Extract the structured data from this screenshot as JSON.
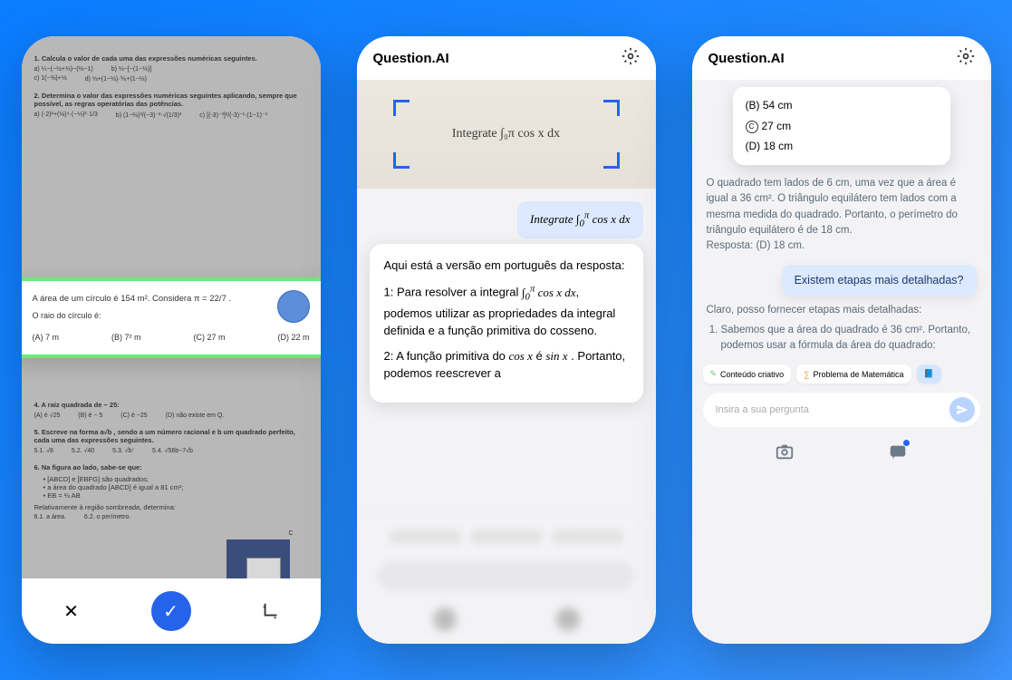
{
  "phone1": {
    "sections": {
      "s1_title": "1. Calcula o valor de cada uma das expressões numéricas seguintes.",
      "s2_title": "2. Determina o valor das expressões numéricas seguintes aplicando, sempre que possível, as regras operatórias das potências.",
      "s4_title": "4. A raiz quadrada de − 25:",
      "s4_a": "(A) é √25",
      "s4_b": "(B) é − 5",
      "s4_c": "(C) é −25",
      "s4_d": "(D) não existe em Q.",
      "s5_title": "5. Escreve na forma a√b , sendo a um número racional e b um quadrado perfeito, cada uma das expressões seguintes.",
      "s5_1": "5.1. √8",
      "s5_2": "5.2. √40",
      "s5_3": "5.3. √b⁷",
      "s5_4": "5.4. √56b−7√b",
      "s6_title": "6. Na figura ao lado, sabe-se que:",
      "s6_b1": "• [ABCD] e [EBFG] são quadrados;",
      "s6_b2": "• a área do quadrado [ABCD] é igual a 81 cm²;",
      "s6_b3": "• EB = ⅔ AB",
      "s6_rel": "Relativamente à região sombreada, determina:",
      "s6_1": "6.1.   a área.",
      "s6_2": "6.2.   o perímetro."
    },
    "highlight": {
      "question": "A área de um círculo é 154 m². Considera π = 22/7 .",
      "prompt": "O raio do círculo é:",
      "opts": {
        "a": "(A) 7 m",
        "b": "(B) 7² m",
        "c": "(C) 27 m",
        "d": "(D) 22 m"
      }
    },
    "buttons": {
      "close": "✕",
      "confirm": "✓",
      "crop": "⌐"
    }
  },
  "phone2": {
    "brand": "Question.AI",
    "handwriting": "Integrate ∫₀π cos x dx",
    "query": "Integrate ∫₀π cos x dx",
    "answer_intro": "Aqui está a versão em português da resposta:",
    "answer_step1": "1: Para resolver a integral ∫₀π cos x dx, podemos utilizar as propriedades da integral definida e a função primitiva do cosseno.",
    "answer_step2": "2: A função primitiva do cos x é sin x. Portanto, podemos reescrever a"
  },
  "phone3": {
    "brand": "Question.AI",
    "options": {
      "b": "(B) 54 cm",
      "c_label": "27 cm",
      "d": "(D) 18 cm"
    },
    "answer": "O quadrado tem lados de 6 cm, uma vez que a área é igual a 36 cm². O triângulo equilátero tem lados com a mesma medida do quadrado. Portanto, o perímetro do triângulo equilátero é de 18 cm.",
    "answer_final": "Resposta: (D) 18 cm.",
    "user": "Existem etapas mais detalhadas?",
    "bot_intro": "Claro, posso fornecer etapas mais detalhadas:",
    "bot_step1": "Sabemos que a área do quadrado é 36 cm². Portanto, podemos usar a fórmula da área do quadrado:",
    "chips": {
      "a": "Conteúdo criativo",
      "b": "Problema de Matemática"
    },
    "input_placeholder": "Insira a sua pergunta"
  }
}
